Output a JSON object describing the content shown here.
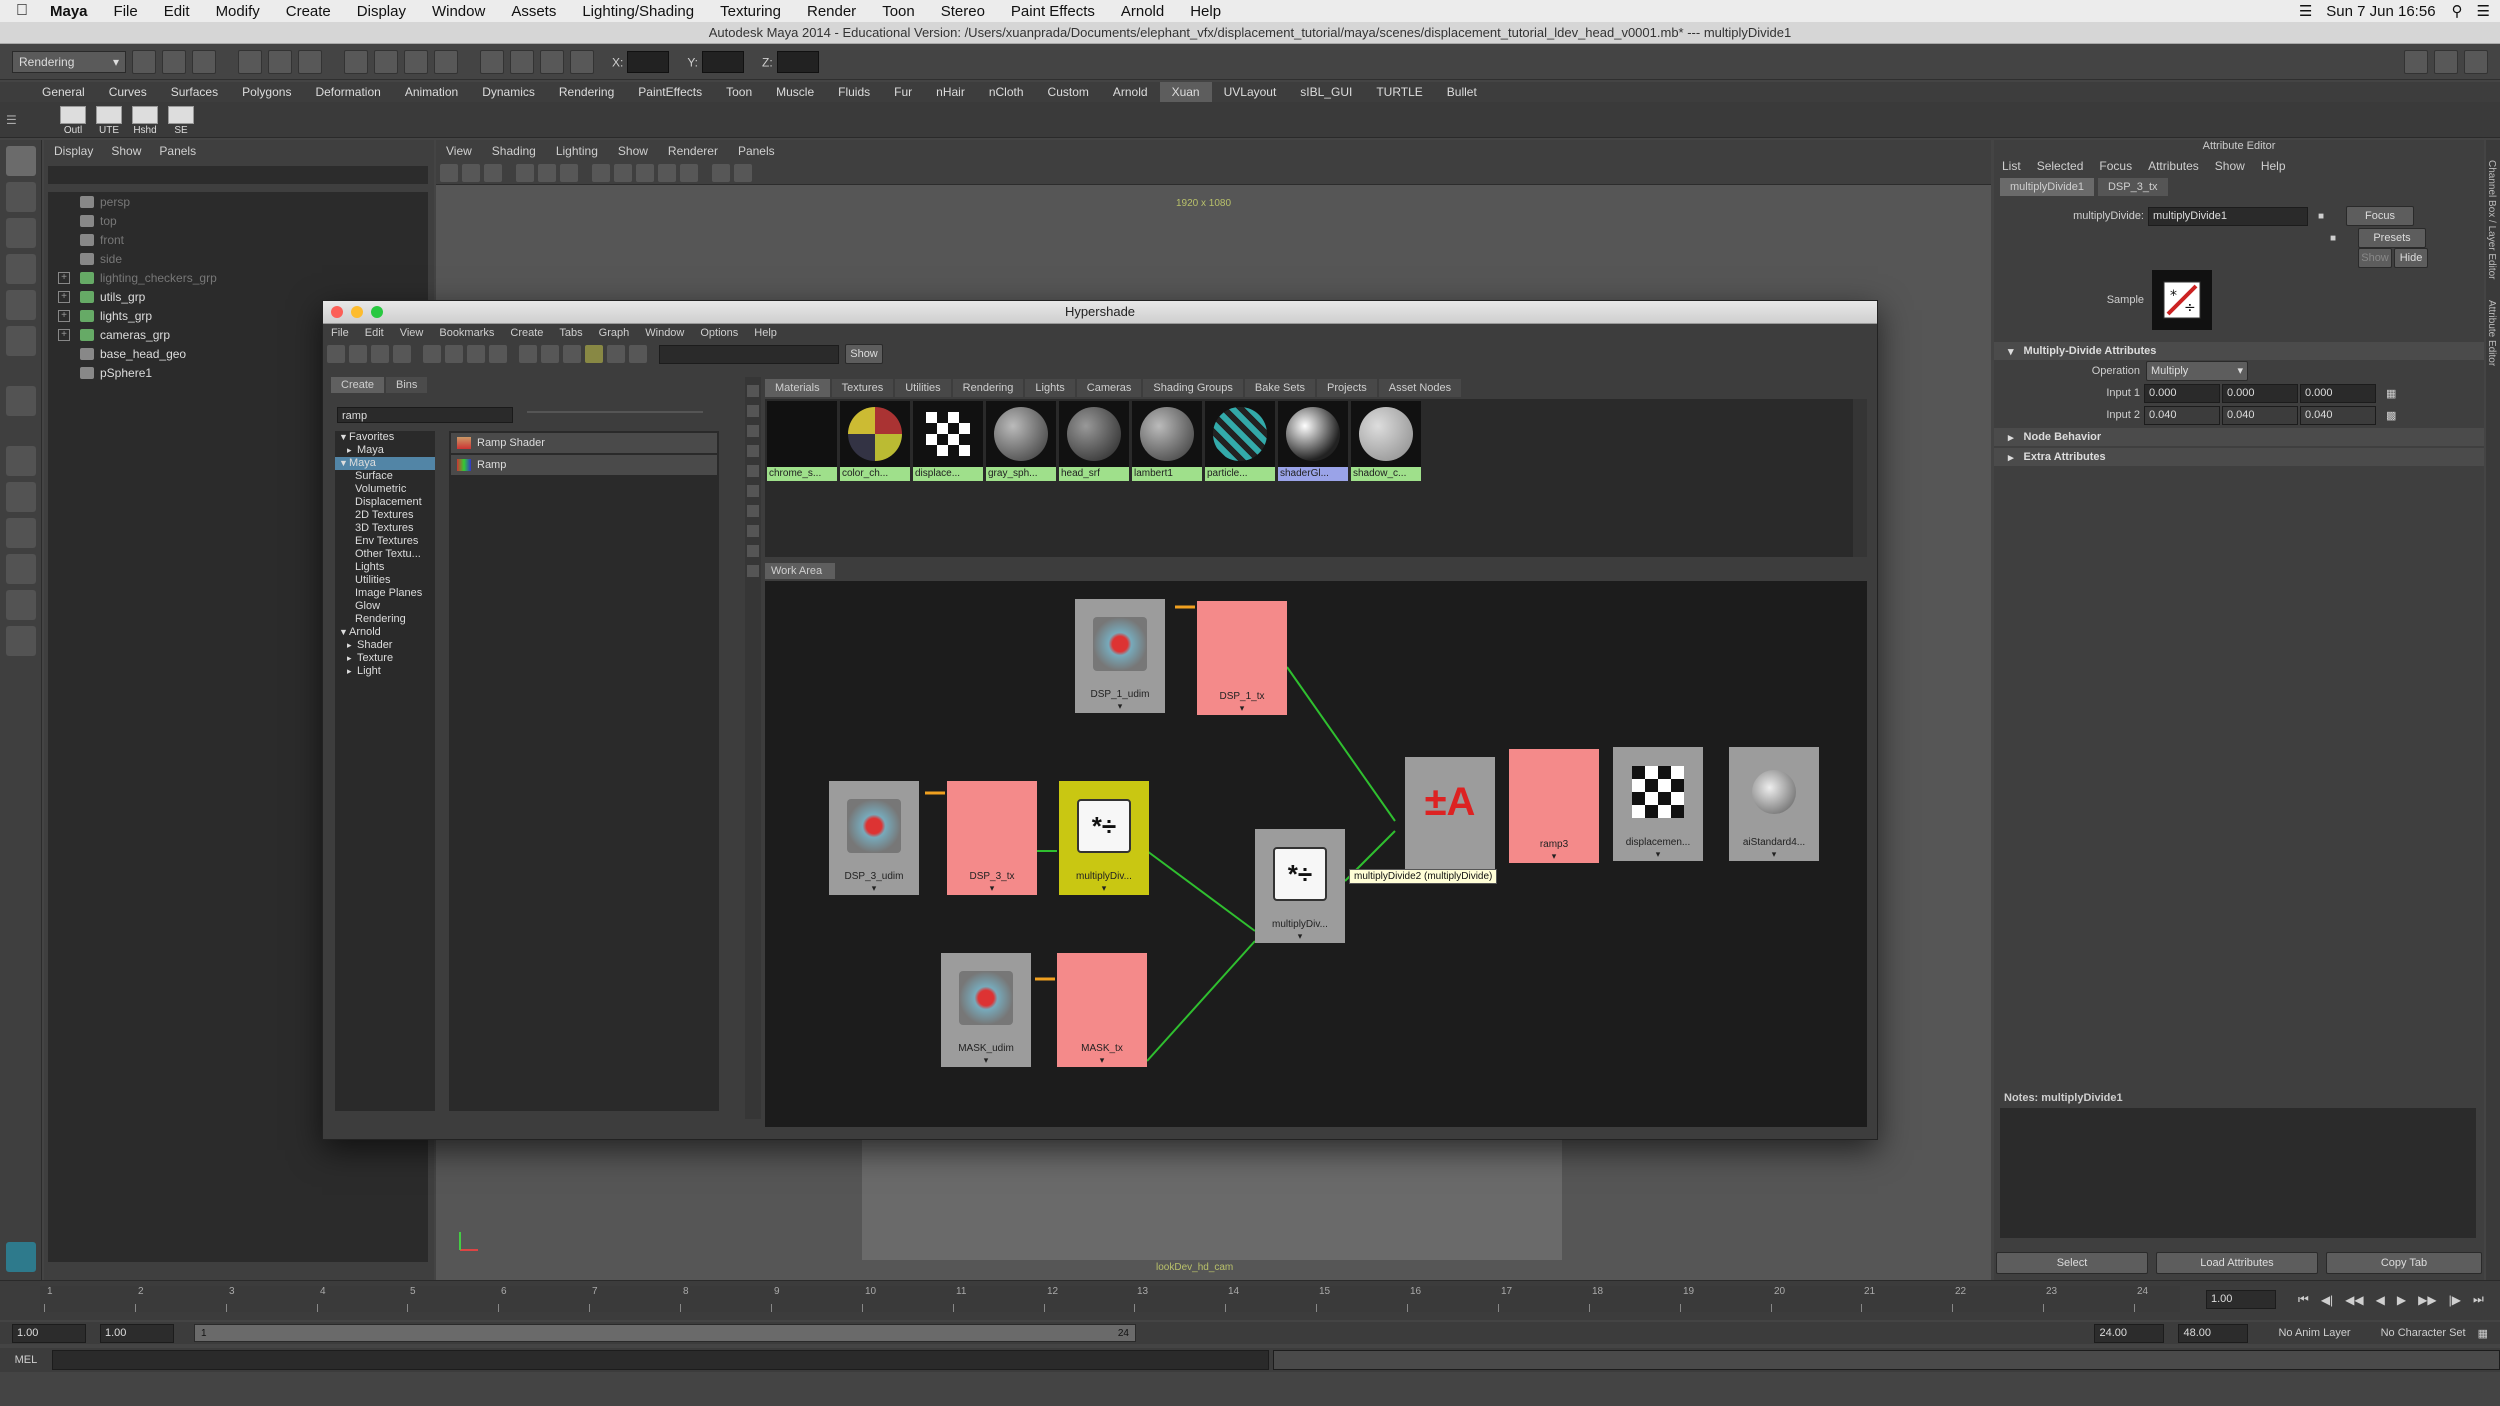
{
  "menubar": {
    "app": "Maya",
    "items": [
      "File",
      "Edit",
      "Modify",
      "Create",
      "Display",
      "Window",
      "Assets",
      "Lighting/Shading",
      "Texturing",
      "Render",
      "Toon",
      "Stereo",
      "Paint Effects",
      "Arnold",
      "Help"
    ],
    "clock": "Sun 7 Jun  16:56"
  },
  "window_title": "Autodesk Maya 2014 - Educational Version: /Users/xuanprada/Documents/elephant_vfx/displacement_tutorial/maya/scenes/displacement_tutorial_ldev_head_v0001.mb*  ---  multiplyDivide1",
  "toolbar": {
    "mode": "Rendering",
    "x_label": "X:",
    "y_label": "Y:",
    "z_label": "Z:"
  },
  "shelf_tabs": [
    "General",
    "Curves",
    "Surfaces",
    "Polygons",
    "Deformation",
    "Animation",
    "Dynamics",
    "Rendering",
    "PaintEffects",
    "Toon",
    "Muscle",
    "Fluids",
    "Fur",
    "nHair",
    "nCloth",
    "Custom",
    "Arnold",
    "Xuan",
    "UVLayout",
    "sIBL_GUI",
    "TURTLE",
    "Bullet"
  ],
  "shelf_active": "Xuan",
  "shelf_buttons": [
    "Outl",
    "UTE",
    "Hshd",
    "SE"
  ],
  "outliner": {
    "menu": [
      "Display",
      "Show",
      "Panels"
    ],
    "items": [
      {
        "label": "persp",
        "kind": "cam",
        "dim": true,
        "expand": false
      },
      {
        "label": "top",
        "kind": "cam",
        "dim": true,
        "expand": false
      },
      {
        "label": "front",
        "kind": "cam",
        "dim": true,
        "expand": false
      },
      {
        "label": "side",
        "kind": "cam",
        "dim": true,
        "expand": false
      },
      {
        "label": "lighting_checkers_grp",
        "kind": "grp",
        "dim": true,
        "expand": true
      },
      {
        "label": "utils_grp",
        "kind": "grp",
        "dim": false,
        "expand": true
      },
      {
        "label": "lights_grp",
        "kind": "grp",
        "dim": false,
        "expand": true
      },
      {
        "label": "cameras_grp",
        "kind": "grp",
        "dim": false,
        "expand": true
      },
      {
        "label": "base_head_geo",
        "kind": "cam",
        "dim": false,
        "expand": false
      },
      {
        "label": "pSphere1",
        "kind": "cam",
        "dim": false,
        "expand": false
      }
    ]
  },
  "viewport": {
    "menu": [
      "View",
      "Shading",
      "Lighting",
      "Show",
      "Renderer",
      "Panels"
    ],
    "resolution": "1920 x 1080",
    "camera": "lookDev_hd_cam"
  },
  "attribute_editor": {
    "title": "Attribute Editor",
    "menu": [
      "List",
      "Selected",
      "Focus",
      "Attributes",
      "Show",
      "Help"
    ],
    "tabs": [
      "multiplyDivide1",
      "DSP_3_tx"
    ],
    "node_type_label": "multiplyDivide:",
    "node_name": "multiplyDivide1",
    "focus_btn": "Focus",
    "presets_btn": "Presets",
    "show_btn": "Show",
    "hide_btn": "Hide",
    "sample_label": "Sample",
    "section_main": "Multiply-Divide Attributes",
    "operation_label": "Operation",
    "operation_value": "Multiply",
    "input1_label": "Input 1",
    "input1": [
      "0.000",
      "0.000",
      "0.000"
    ],
    "input2_label": "Input 2",
    "input2": [
      "0.040",
      "0.040",
      "0.040"
    ],
    "section_behavior": "Node Behavior",
    "section_extra": "Extra Attributes",
    "notes": "Notes:  multiplyDivide1",
    "select_btn": "Select",
    "load_btn": "Load Attributes",
    "copy_btn": "Copy Tab"
  },
  "right_strip": [
    "Channel Box / Layer Editor",
    "Attribute Editor"
  ],
  "hypershade": {
    "title": "Hypershade",
    "menu": [
      "File",
      "Edit",
      "View",
      "Bookmarks",
      "Create",
      "Tabs",
      "Graph",
      "Window",
      "Options",
      "Help"
    ],
    "show_btn": "Show",
    "left_tabs": [
      "Create",
      "Bins"
    ],
    "search": "ramp",
    "tree": [
      {
        "label": "Favorites",
        "indent": 0,
        "sel": false,
        "arrow": "▼"
      },
      {
        "label": "Maya",
        "indent": 1,
        "sel": false,
        "arrow": "▸"
      },
      {
        "label": "Maya",
        "indent": 0,
        "sel": true,
        "arrow": "▼"
      },
      {
        "label": "Surface",
        "indent": 2,
        "sel": false,
        "arrow": ""
      },
      {
        "label": "Volumetric",
        "indent": 2,
        "sel": false,
        "arrow": ""
      },
      {
        "label": "Displacement",
        "indent": 2,
        "sel": false,
        "arrow": ""
      },
      {
        "label": "2D Textures",
        "indent": 2,
        "sel": false,
        "arrow": ""
      },
      {
        "label": "3D Textures",
        "indent": 2,
        "sel": false,
        "arrow": ""
      },
      {
        "label": "Env Textures",
        "indent": 2,
        "sel": false,
        "arrow": ""
      },
      {
        "label": "Other Textu...",
        "indent": 2,
        "sel": false,
        "arrow": ""
      },
      {
        "label": "Lights",
        "indent": 2,
        "sel": false,
        "arrow": ""
      },
      {
        "label": "Utilities",
        "indent": 2,
        "sel": false,
        "arrow": ""
      },
      {
        "label": "Image Planes",
        "indent": 2,
        "sel": false,
        "arrow": ""
      },
      {
        "label": "Glow",
        "indent": 2,
        "sel": false,
        "arrow": ""
      },
      {
        "label": "Rendering",
        "indent": 2,
        "sel": false,
        "arrow": ""
      },
      {
        "label": "Arnold",
        "indent": 0,
        "sel": false,
        "arrow": "▼"
      },
      {
        "label": "Shader",
        "indent": 1,
        "sel": false,
        "arrow": "▸"
      },
      {
        "label": "Texture",
        "indent": 1,
        "sel": false,
        "arrow": "▸"
      },
      {
        "label": "Light",
        "indent": 1,
        "sel": false,
        "arrow": "▸"
      }
    ],
    "results": [
      "Ramp Shader",
      "Ramp"
    ],
    "mat_tabs": [
      "Materials",
      "Textures",
      "Utilities",
      "Rendering",
      "Lights",
      "Cameras",
      "Shading Groups",
      "Bake Sets",
      "Projects",
      "Asset Nodes"
    ],
    "swatches": [
      {
        "label": "chrome_s...",
        "kind": "black",
        "sel": false
      },
      {
        "label": "color_ch...",
        "kind": "color",
        "sel": false
      },
      {
        "label": "displace...",
        "kind": "checker",
        "sel": false
      },
      {
        "label": "gray_sph...",
        "kind": "gray",
        "sel": false
      },
      {
        "label": "head_srf",
        "kind": "dark",
        "sel": false
      },
      {
        "label": "lambert1",
        "kind": "gray",
        "sel": false
      },
      {
        "label": "particle...",
        "kind": "particle",
        "sel": false
      },
      {
        "label": "shaderGl...",
        "kind": "chrome",
        "sel": true
      },
      {
        "label": "shadow_c...",
        "kind": "light",
        "sel": false
      }
    ],
    "work_area_tab": "Work Area",
    "nodes": {
      "dsp1_udim": "DSP_1_udim",
      "dsp1_tx": "DSP_1_tx",
      "dsp3_udim": "DSP_3_udim",
      "dsp3_tx": "DSP_3_tx",
      "md1": "multiplyDiv...",
      "md2": "multiplyDiv...",
      "mask_udim": "MASK_udim",
      "mask_tx": "MASK_tx",
      "pma": "",
      "ramp3": "ramp3",
      "disp": "displacemen...",
      "ai": "aiStandard4..."
    },
    "tooltip": "multiplyDivide2 (multiplyDivide)"
  },
  "timeline": {
    "ticks": [
      "1",
      "2",
      "3",
      "4",
      "5",
      "6",
      "7",
      "8",
      "9",
      "10",
      "11",
      "12",
      "13",
      "14",
      "15",
      "16",
      "17",
      "18",
      "19",
      "20",
      "21",
      "22",
      "23",
      "24"
    ],
    "current": "1.00",
    "start": "1.00",
    "range_start_inner": "1.00",
    "range_marker": "1",
    "range_end_marker": "24",
    "end_inner": "24.00",
    "end": "48.00",
    "anim_layer": "No Anim Layer",
    "char_set": "No Character Set"
  },
  "cmdline": {
    "label": "MEL"
  }
}
